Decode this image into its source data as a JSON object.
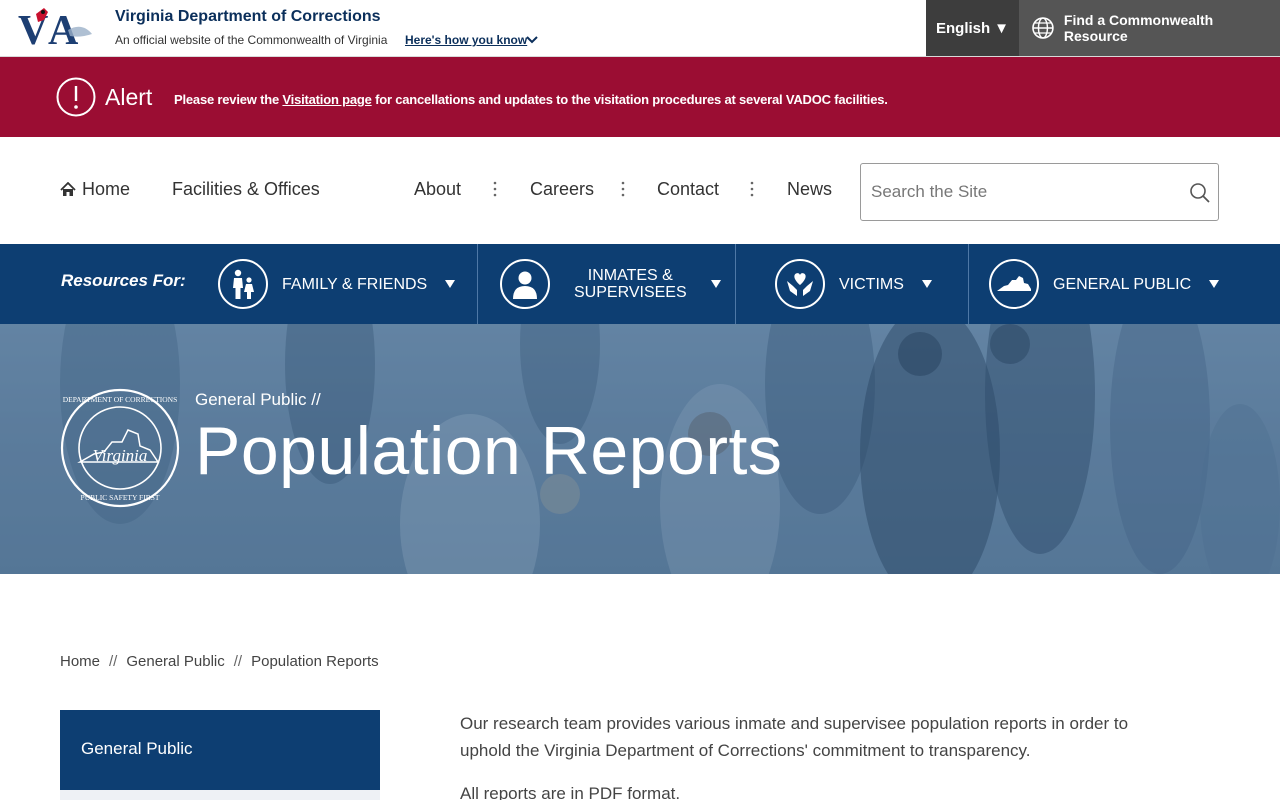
{
  "header": {
    "agency_name": "Virginia Department of Corrections",
    "official_text": "An official website of the Commonwealth of Virginia",
    "how_you_know": "Here's how you know",
    "language": "English",
    "commonwealth_resource": "Find a Commonwealth Resource"
  },
  "alert": {
    "title": "Alert",
    "text_before": "Please review the ",
    "link_text": "Visitation page",
    "text_after": " for cancellations and updates to the visitation procedures at several VADOC facilities."
  },
  "nav": {
    "home": "Home",
    "facilities": "Facilities & Offices",
    "about": "About",
    "careers": "Careers",
    "contact": "Contact",
    "news": "News",
    "search_placeholder": "Search the Site"
  },
  "resources": {
    "label": "Resources For:",
    "items": [
      {
        "label": "FAMILY & FRIENDS",
        "icon": "family-icon"
      },
      {
        "label_line1": "INMATES &",
        "label_line2": "SUPERVISEES",
        "icon": "person-icon"
      },
      {
        "label": "VICTIMS",
        "icon": "hands-heart-icon"
      },
      {
        "label": "GENERAL PUBLIC",
        "icon": "virginia-map-icon"
      }
    ]
  },
  "hero": {
    "section": "General Public",
    "separator": "//",
    "title": "Population Reports",
    "seal_top": "DEPARTMENT OF CORRECTIONS",
    "seal_center": "Virginia",
    "seal_bottom": "PUBLIC SAFETY FIRST"
  },
  "breadcrumb": {
    "items": [
      "Home",
      "General Public",
      "Population Reports"
    ],
    "separator": "//"
  },
  "sidebar": {
    "title": "General Public"
  },
  "content": {
    "intro": "Our research team provides various inmate and supervisee population reports in order to uphold the Virginia Department of Corrections' commitment to transparency.",
    "format_note": "All reports are in PDF format."
  },
  "colors": {
    "alert_bg": "#9b0d33",
    "navy": "#0d3e72",
    "title_navy": "#0b2f5b"
  }
}
